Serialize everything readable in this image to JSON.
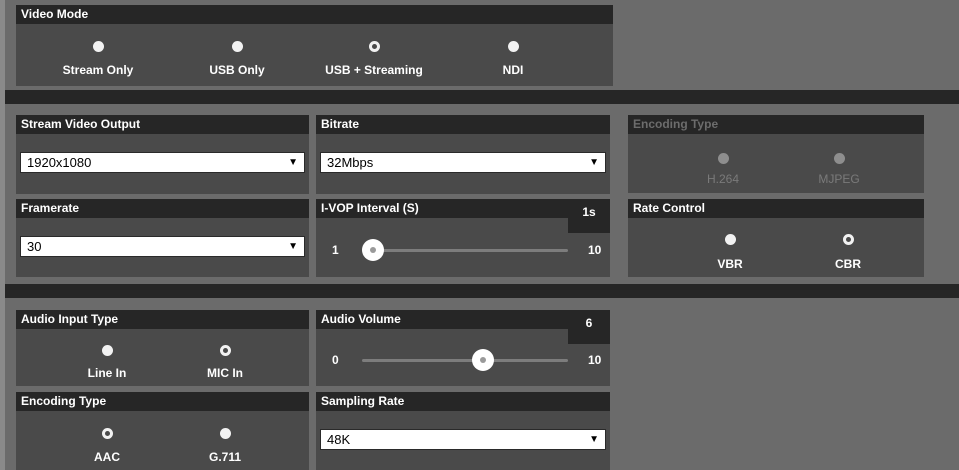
{
  "video_mode": {
    "title": "Video Mode",
    "options": [
      {
        "label": "Stream Only",
        "checked": false
      },
      {
        "label": "USB Only",
        "checked": false
      },
      {
        "label": "USB + Streaming",
        "checked": true
      },
      {
        "label": "NDI",
        "checked": false
      }
    ]
  },
  "stream": {
    "output": {
      "title": "Stream Video Output",
      "value": "1920x1080"
    },
    "bitrate": {
      "title": "Bitrate",
      "value": "32Mbps"
    },
    "encoding_type": {
      "title": "Encoding Type",
      "disabled": true,
      "options": [
        {
          "label": "H.264",
          "checked": true
        },
        {
          "label": "MJPEG",
          "checked": false
        }
      ]
    },
    "framerate": {
      "title": "Framerate",
      "value": "30"
    },
    "ivop": {
      "title": "I-VOP Interval (S)",
      "badge": "1s",
      "min": "1",
      "max": "10",
      "value": 1,
      "range": [
        1,
        10
      ]
    },
    "rate_control": {
      "title": "Rate Control",
      "options": [
        {
          "label": "VBR",
          "checked": false
        },
        {
          "label": "CBR",
          "checked": true
        }
      ]
    }
  },
  "audio": {
    "input_type": {
      "title": "Audio Input Type",
      "options": [
        {
          "label": "Line In",
          "checked": false
        },
        {
          "label": "MIC In",
          "checked": true
        }
      ]
    },
    "volume": {
      "title": "Audio Volume",
      "badge": "6",
      "min": "0",
      "max": "10",
      "value": 6,
      "range": [
        0,
        10
      ]
    },
    "encoding_type": {
      "title": "Encoding Type",
      "options": [
        {
          "label": "AAC",
          "checked": true
        },
        {
          "label": "G.711",
          "checked": false
        }
      ]
    },
    "sampling_rate": {
      "title": "Sampling Rate",
      "value": "48K"
    }
  },
  "icons": {
    "dropdown": "▼"
  }
}
